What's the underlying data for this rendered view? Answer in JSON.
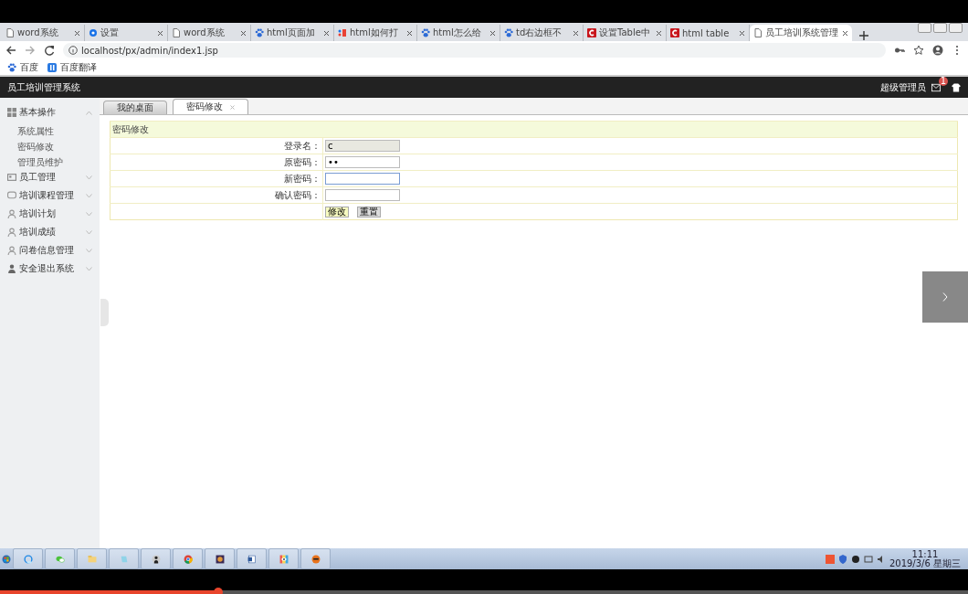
{
  "browser": {
    "tabs": [
      {
        "title": "word系统",
        "kind": "doc",
        "selected": false
      },
      {
        "title": "设置",
        "kind": "gear",
        "selected": false
      },
      {
        "title": "word系统",
        "kind": "doc",
        "selected": false
      },
      {
        "title": "html页面加",
        "kind": "paw",
        "selected": false
      },
      {
        "title": "html如何打",
        "kind": "h5",
        "selected": false
      },
      {
        "title": "html怎么给",
        "kind": "paw",
        "selected": false
      },
      {
        "title": "td右边框不",
        "kind": "paw",
        "selected": false
      },
      {
        "title": "设置Table中",
        "kind": "c",
        "selected": false
      },
      {
        "title": "html table",
        "kind": "c",
        "selected": false
      },
      {
        "title": "员工培训系统管理",
        "kind": "doc",
        "selected": true
      }
    ],
    "address": "localhost/px/admin/index1.jsp",
    "bookmarks": [
      {
        "label": "百度",
        "kind": "paw"
      },
      {
        "label": "百度翻译",
        "kind": "translate"
      }
    ]
  },
  "app": {
    "title": "员工培训管理系统",
    "user": "超级管理员",
    "badge": "1",
    "sidebar": [
      {
        "label": "基本操作",
        "kind": "grid",
        "expanded": true,
        "children": [
          {
            "label": "系统属性"
          },
          {
            "label": "密码修改"
          },
          {
            "label": "管理员维护"
          }
        ]
      },
      {
        "label": "员工管理",
        "kind": "card",
        "expanded": false
      },
      {
        "label": "培训课程管理",
        "kind": "chat",
        "expanded": false
      },
      {
        "label": "培训计划",
        "kind": "person",
        "expanded": false
      },
      {
        "label": "培训成绩",
        "kind": "person",
        "expanded": false
      },
      {
        "label": "问卷信息管理",
        "kind": "person",
        "expanded": false
      },
      {
        "label": "安全退出系统",
        "kind": "user",
        "expanded": false
      }
    ],
    "page_tabs": [
      {
        "label": "我的桌面",
        "selected": false,
        "closable": false
      },
      {
        "label": "密码修改",
        "selected": true,
        "closable": true
      }
    ],
    "form": {
      "title": "密码修改",
      "fields": [
        {
          "label": "登录名：",
          "value": "c",
          "disabled": true,
          "focused": false
        },
        {
          "label": "原密码：",
          "value": "••",
          "disabled": false,
          "focused": false
        },
        {
          "label": "新密码：",
          "disabled": false,
          "focused": true
        },
        {
          "label": "确认密码：",
          "disabled": false,
          "focused": false
        }
      ],
      "buttons": [
        {
          "label": "修改",
          "kind": "primary"
        },
        {
          "label": "重置",
          "kind": "secondary"
        }
      ]
    }
  },
  "taskbar": {
    "time": "11:11",
    "date": "2019/3/6 星期三"
  },
  "player": {
    "level": 0.225
  }
}
